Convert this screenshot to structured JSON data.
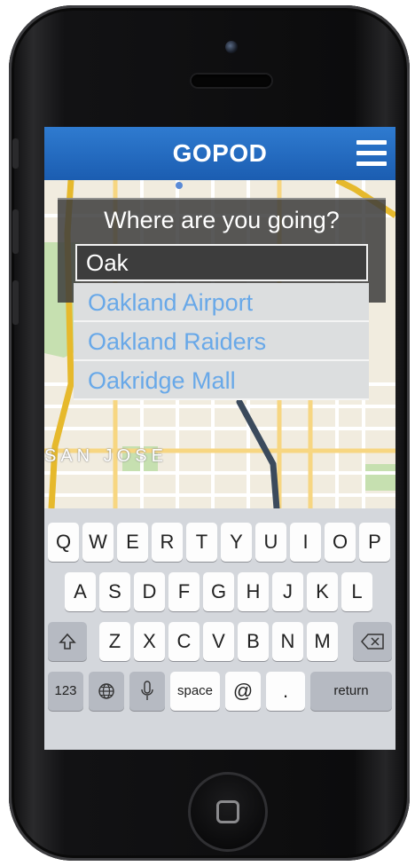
{
  "app": {
    "title": "GOPOD"
  },
  "search": {
    "prompt": "Where are you going?",
    "value": "Oak",
    "suggestions": [
      "Oakland Airport",
      "Oakland Raiders",
      "Oakridge Mall"
    ]
  },
  "map": {
    "city_label": "SAN JOSE"
  },
  "keyboard": {
    "row1": [
      "Q",
      "W",
      "E",
      "R",
      "T",
      "Y",
      "U",
      "I",
      "O",
      "P"
    ],
    "row2": [
      "A",
      "S",
      "D",
      "F",
      "G",
      "H",
      "J",
      "K",
      "L"
    ],
    "row3": [
      "Z",
      "X",
      "C",
      "V",
      "B",
      "N",
      "M"
    ],
    "numbers_label": "123",
    "space_label": "space",
    "at_label": "@",
    "period_label": ".",
    "return_label": "return"
  },
  "icons": [
    "menu-icon",
    "shift-icon",
    "backspace-icon",
    "globe-icon",
    "microphone-icon",
    "home-button-icon"
  ],
  "colors": {
    "header_blue": "#1f63b8",
    "suggestion_text": "#68a8e8"
  }
}
